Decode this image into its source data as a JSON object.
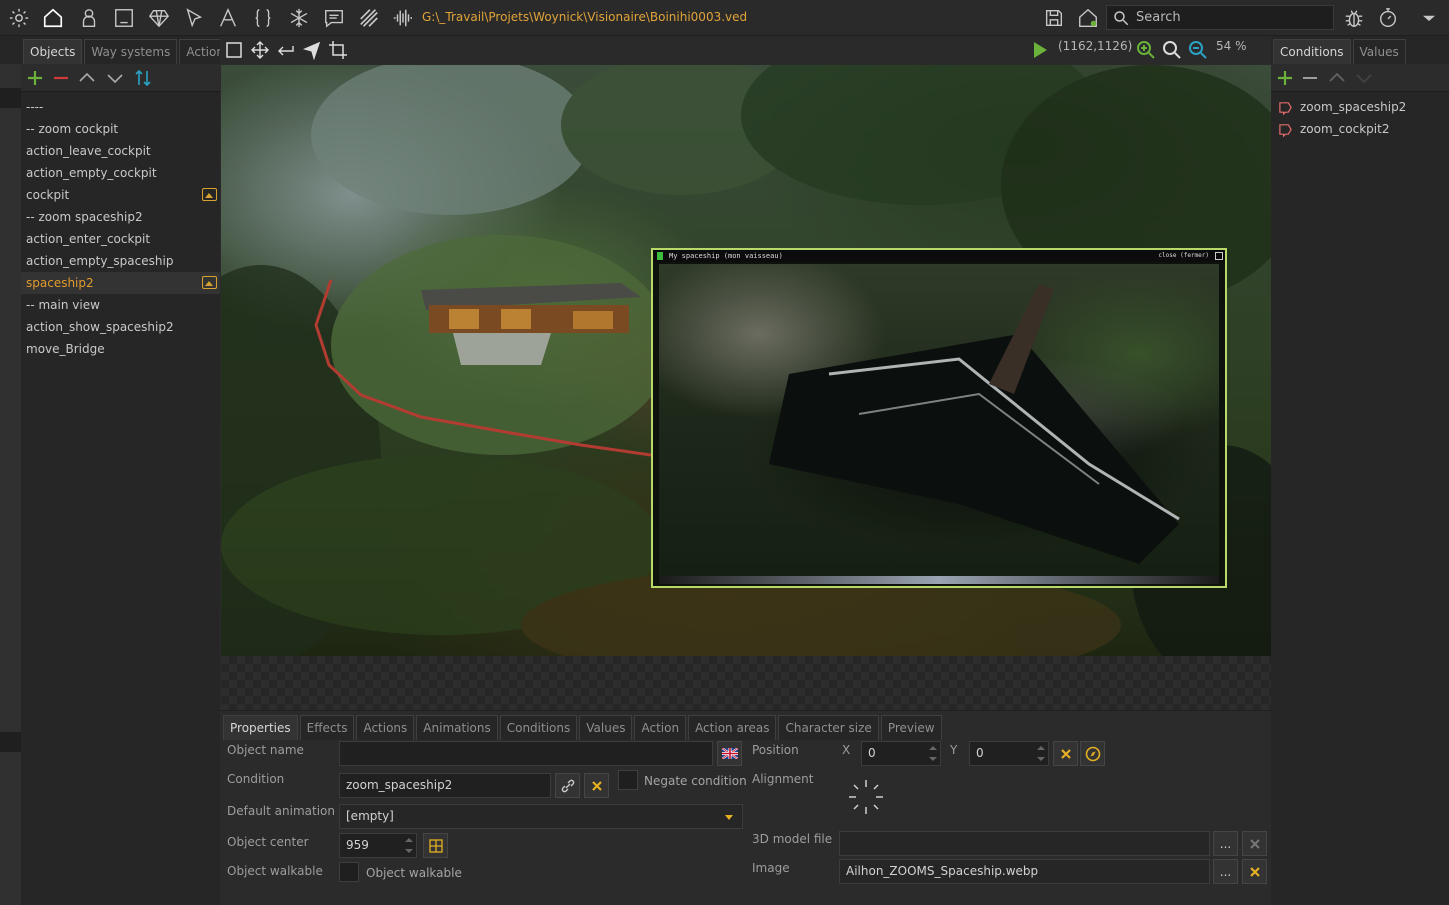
{
  "toolbar": {
    "path": "G:\\_Travail\\Projets\\Woynick\\Visionaire\\Boinihi0003.ved",
    "search_placeholder": "Search",
    "icons": [
      "gear-icon",
      "home-icon",
      "character-icon",
      "interface-icon",
      "gem-icon",
      "cursor-icon",
      "font-icon",
      "braces-icon",
      "snowflake-icon",
      "dialog-icon",
      "stripes-icon",
      "waveform-icon",
      "save-icon",
      "home-outline-icon",
      "search-icon",
      "bug-icon",
      "stopwatch-icon",
      "chevron-down-icon"
    ]
  },
  "left": {
    "tabs": [
      {
        "label": "Objects",
        "active": true
      },
      {
        "label": "Way systems",
        "active": false
      },
      {
        "label": "Actions",
        "active": false
      }
    ],
    "objects": [
      {
        "label": "----",
        "image": false,
        "selected": false
      },
      {
        "label": "-- zoom cockpit",
        "image": false,
        "selected": false
      },
      {
        "label": "action_leave_cockpit",
        "image": false,
        "selected": false
      },
      {
        "label": "action_empty_cockpit",
        "image": false,
        "selected": false
      },
      {
        "label": "cockpit",
        "image": true,
        "selected": false
      },
      {
        "label": "-- zoom spaceship2",
        "image": false,
        "selected": false
      },
      {
        "label": "action_enter_cockpit",
        "image": false,
        "selected": false
      },
      {
        "label": "action_empty_spaceship",
        "image": false,
        "selected": false
      },
      {
        "label": "spaceship2",
        "image": true,
        "selected": true
      },
      {
        "label": "-- main view",
        "image": false,
        "selected": false
      },
      {
        "label": "action_show_spaceship2",
        "image": false,
        "selected": false
      },
      {
        "label": "move_Bridge",
        "image": false,
        "selected": false
      }
    ]
  },
  "canvas": {
    "coords": "(1162,1126)",
    "zoom": "54 %",
    "ingame_title": "My spaceship (mon vaisseau)",
    "ingame_close": "close (fermer)"
  },
  "right": {
    "tabs": [
      {
        "label": "Conditions",
        "active": true
      },
      {
        "label": "Values",
        "active": false
      }
    ],
    "conditions": [
      "zoom_spaceship2",
      "zoom_cockpit2"
    ]
  },
  "props": {
    "tabs": [
      {
        "label": "Properties",
        "active": true
      },
      {
        "label": "Effects",
        "active": false
      },
      {
        "label": "Actions",
        "active": false
      },
      {
        "label": "Animations",
        "active": false
      },
      {
        "label": "Conditions",
        "active": false
      },
      {
        "label": "Values",
        "active": false
      },
      {
        "label": "Action",
        "active": false
      },
      {
        "label": "Action areas",
        "active": false
      },
      {
        "label": "Character size",
        "active": false
      },
      {
        "label": "Preview",
        "active": false
      }
    ],
    "object_name_label": "Object name",
    "object_name_value": "",
    "condition_label": "Condition",
    "condition_value": "zoom_spaceship2",
    "negate_label": "Negate condition",
    "default_anim_label": "Default animation",
    "default_anim_value": "[empty]",
    "object_center_label": "Object center",
    "object_center_value": "959",
    "walkable_label": "Object walkable",
    "walkable_check_label": "Object walkable",
    "position_label": "Position",
    "pos_x_label": "X",
    "pos_x_value": "0",
    "pos_y_label": "Y",
    "pos_y_value": "0",
    "alignment_label": "Alignment",
    "model_label": "3D model file",
    "model_value": "",
    "image_label": "Image",
    "image_value": "Ailhon_ZOOMS_Spaceship.webp",
    "more_label": "..."
  },
  "colors": {
    "accent": "#e09b2d",
    "green": "#6ab23a",
    "window_border": "#b9d86a",
    "cond_icon": "#e26b6b"
  }
}
